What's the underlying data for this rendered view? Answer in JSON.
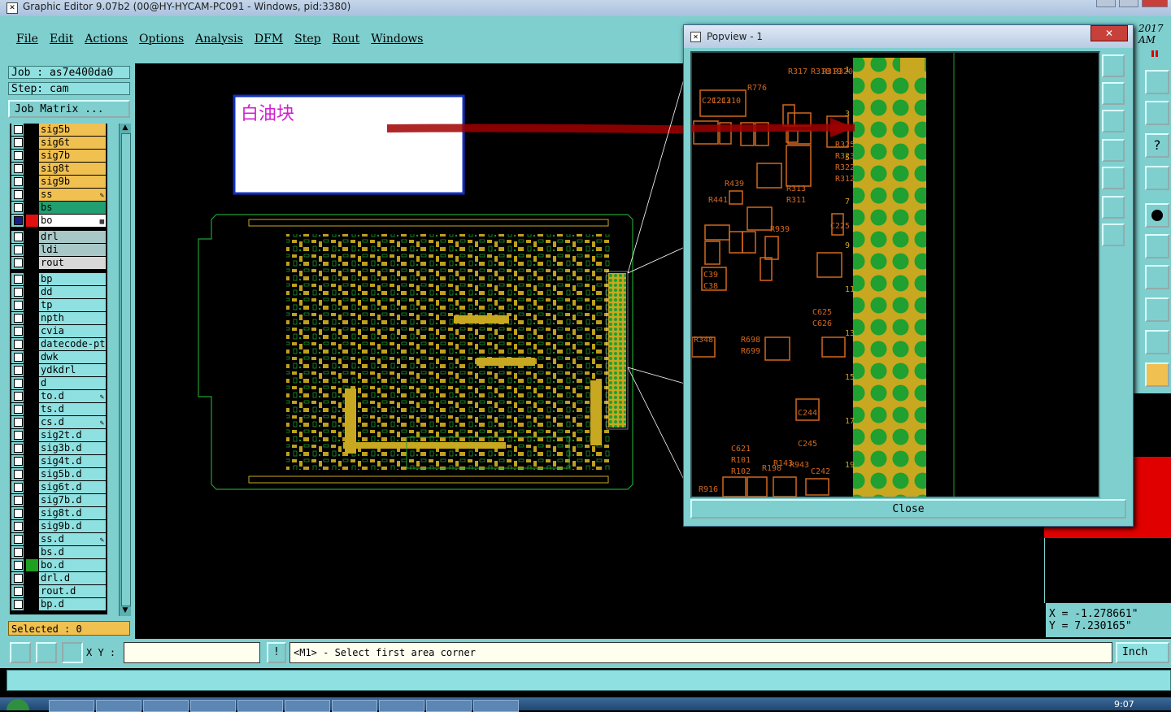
{
  "window": {
    "title": "Graphic Editor 9.07b2 (00@HY-HYCAM-PC091 - Windows, pid:3380)"
  },
  "menu": [
    "File",
    "Edit",
    "Actions",
    "Options",
    "Analysis",
    "DFM",
    "Step",
    "Rout",
    "Windows"
  ],
  "job": {
    "job_label": "Job : as7e400da0",
    "step_label": "Step: cam",
    "matrix_button": "Job Matrix ..."
  },
  "layers": [
    {
      "name": "sig5b",
      "color": "#f0c050",
      "mark": ""
    },
    {
      "name": "sig6t",
      "color": "#f0c050",
      "mark": ""
    },
    {
      "name": "sig7b",
      "color": "#f0c050",
      "mark": ""
    },
    {
      "name": "sig8t",
      "color": "#f0c050",
      "mark": ""
    },
    {
      "name": "sig9b",
      "color": "#f0c050",
      "mark": ""
    },
    {
      "name": "ss",
      "color": "#f0c050",
      "mark": "✎"
    },
    {
      "name": "bs",
      "color": "#20a070",
      "mark": ""
    },
    {
      "name": "bo",
      "color": "#ffffff",
      "mark": "▦"
    },
    {
      "name": "drl",
      "color": "#a8c8c8",
      "mark": ""
    },
    {
      "name": "ldi",
      "color": "#a8c8c8",
      "mark": ""
    },
    {
      "name": "rout",
      "color": "#d8d8d8",
      "mark": ""
    },
    {
      "name": "bp",
      "color": "#8fe0e0",
      "mark": ""
    },
    {
      "name": "dd",
      "color": "#8fe0e0",
      "mark": ""
    },
    {
      "name": "tp",
      "color": "#8fe0e0",
      "mark": ""
    },
    {
      "name": "npth",
      "color": "#8fe0e0",
      "mark": ""
    },
    {
      "name": "cvia",
      "color": "#8fe0e0",
      "mark": ""
    },
    {
      "name": "datecode-pth",
      "color": "#8fe0e0",
      "mark": ""
    },
    {
      "name": "dwk",
      "color": "#8fe0e0",
      "mark": ""
    },
    {
      "name": "ydkdrl",
      "color": "#8fe0e0",
      "mark": ""
    },
    {
      "name": "d",
      "color": "#8fe0e0",
      "mark": ""
    },
    {
      "name": "to.d",
      "color": "#8fe0e0",
      "mark": "✎"
    },
    {
      "name": "ts.d",
      "color": "#8fe0e0",
      "mark": ""
    },
    {
      "name": "cs.d",
      "color": "#8fe0e0",
      "mark": "✎"
    },
    {
      "name": "sig2t.d",
      "color": "#8fe0e0",
      "mark": ""
    },
    {
      "name": "sig3b.d",
      "color": "#8fe0e0",
      "mark": ""
    },
    {
      "name": "sig4t.d",
      "color": "#8fe0e0",
      "mark": ""
    },
    {
      "name": "sig5b.d",
      "color": "#8fe0e0",
      "mark": ""
    },
    {
      "name": "sig6t.d",
      "color": "#8fe0e0",
      "mark": ""
    },
    {
      "name": "sig7b.d",
      "color": "#8fe0e0",
      "mark": ""
    },
    {
      "name": "sig8t.d",
      "color": "#8fe0e0",
      "mark": ""
    },
    {
      "name": "sig9b.d",
      "color": "#8fe0e0",
      "mark": ""
    },
    {
      "name": "ss.d",
      "color": "#8fe0e0",
      "mark": "✎"
    },
    {
      "name": "bs.d",
      "color": "#8fe0e0",
      "mark": ""
    },
    {
      "name": "bo.d",
      "color": "#8fe0e0",
      "mark": ""
    },
    {
      "name": "drl.d",
      "color": "#8fe0e0",
      "mark": ""
    },
    {
      "name": "rout.d",
      "color": "#8fe0e0",
      "mark": ""
    },
    {
      "name": "bp.d",
      "color": "#8fe0e0",
      "mark": ""
    }
  ],
  "selected_label": "Selected : 0",
  "annotation": {
    "text": "白油块",
    "color": "#d020d0"
  },
  "popview": {
    "title": "Popview - 1",
    "close_label": "Close",
    "row_numbers": [
      "1",
      "3",
      "5",
      "7",
      "9",
      "11",
      "13",
      "15",
      "17",
      "19"
    ],
    "ref_labels": [
      "R776",
      "R317",
      "R318",
      "R319",
      "R320",
      "C212",
      "C213",
      "C210",
      "R441",
      "R439",
      "R325",
      "R323",
      "R322",
      "R312",
      "R313",
      "R311",
      "C39",
      "C38",
      "C225",
      "R939",
      "R698",
      "R699",
      "C244",
      "C245",
      "C242",
      "C621",
      "R101",
      "R102",
      "R198",
      "R143",
      "R348",
      "C625",
      "C626",
      "R943",
      "R916"
    ]
  },
  "coords": {
    "x_label": "X = -1.278661\"",
    "y_label": "Y = 7.230165\""
  },
  "prompt": {
    "xy_label": "X Y :",
    "message": "<M1> - Select first area corner",
    "units": "Inch"
  },
  "clock": {
    "time": "9:07",
    "year_fragment": "2017",
    "ampm": "AM"
  },
  "colors": {
    "panel": "#7fcfcf",
    "pcb_yellow": "#c8a820",
    "pcb_green": "#1fa030",
    "highlight_red": "#b01010"
  }
}
